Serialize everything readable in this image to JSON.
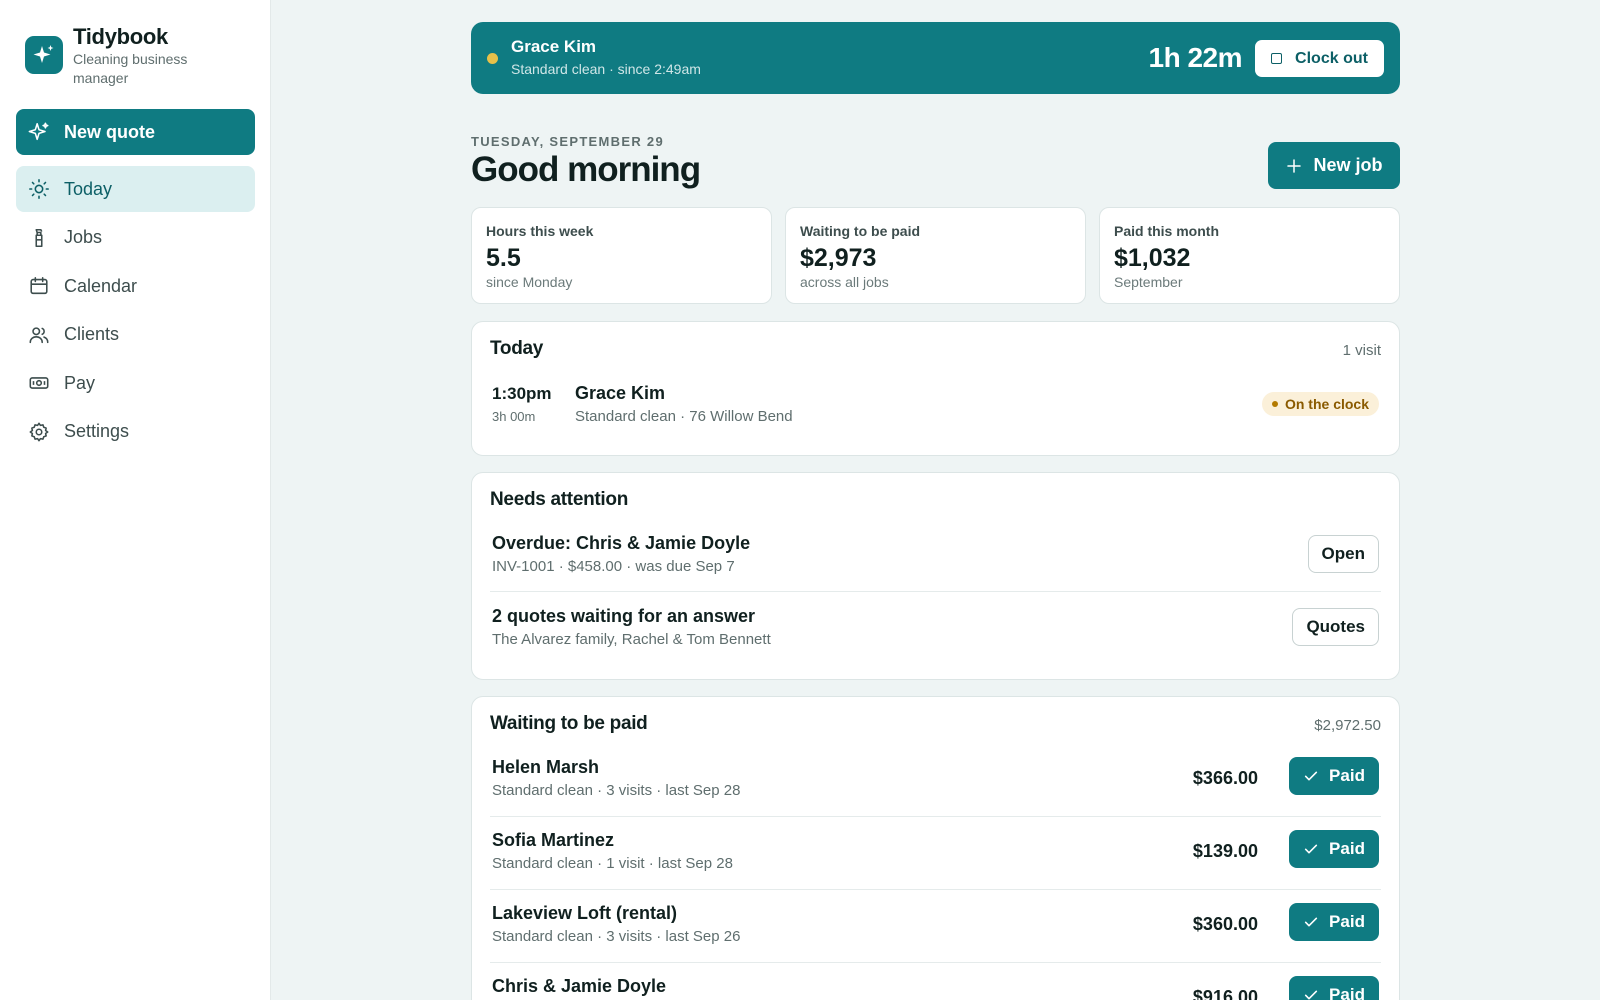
{
  "app": {
    "name": "Tidybook",
    "tagline": "Cleaning business manager",
    "accent": "#0f7b82"
  },
  "sidebar": {
    "new_quote_label": "New quote",
    "items": [
      {
        "label": "Today",
        "icon": "sun-icon",
        "active": true
      },
      {
        "label": "Jobs",
        "icon": "spray-bottle-icon",
        "active": false
      },
      {
        "label": "Calendar",
        "icon": "calendar-icon",
        "active": false
      },
      {
        "label": "Clients",
        "icon": "users-icon",
        "active": false
      },
      {
        "label": "Pay",
        "icon": "banknote-icon",
        "active": false
      },
      {
        "label": "Settings",
        "icon": "gear-icon",
        "active": false
      }
    ]
  },
  "clock": {
    "name": "Grace Kim",
    "subtitle": "Standard clean · since 2:49am",
    "elapsed": "1h 22m",
    "clock_out_label": "Clock out"
  },
  "header": {
    "date": "TUESDAY, SEPTEMBER 29",
    "greeting": "Good morning",
    "new_job_label": "New job"
  },
  "stats": [
    {
      "label": "Hours this week",
      "value": "5.5",
      "sub": "since Monday"
    },
    {
      "label": "Waiting to be paid",
      "value": "$2,973",
      "sub": "across all jobs"
    },
    {
      "label": "Paid this month",
      "value": "$1,032",
      "sub": "September"
    }
  ],
  "today": {
    "title": "Today",
    "count": "1 visit",
    "visit": {
      "time": "1:30pm",
      "duration": "3h 00m",
      "name": "Grace Kim",
      "details": "Standard clean · 76 Willow Bend",
      "status": "On the clock"
    }
  },
  "attention": {
    "title": "Needs attention",
    "items": [
      {
        "title": "Overdue: Chris & Jamie Doyle",
        "sub": "INV-1001 · $458.00 · was due Sep 7",
        "action": "Open"
      },
      {
        "title": "2 quotes waiting for an answer",
        "sub": "The Alvarez family, Rachel & Tom Bennett",
        "action": "Quotes"
      }
    ]
  },
  "waiting": {
    "title": "Waiting to be paid",
    "total": "$2,972.50",
    "paid_label": "Paid",
    "items": [
      {
        "name": "Helen Marsh",
        "sub": "Standard clean · 3 visits · last Sep 28",
        "amount": "$366.00"
      },
      {
        "name": "Sofia Martinez",
        "sub": "Standard clean · 1 visit · last Sep 28",
        "amount": "$139.00"
      },
      {
        "name": "Lakeview Loft (rental)",
        "sub": "Standard clean · 3 visits · last Sep 26",
        "amount": "$360.00"
      },
      {
        "name": "Chris & Jamie Doyle",
        "sub": "",
        "amount": "$916.00"
      }
    ]
  }
}
